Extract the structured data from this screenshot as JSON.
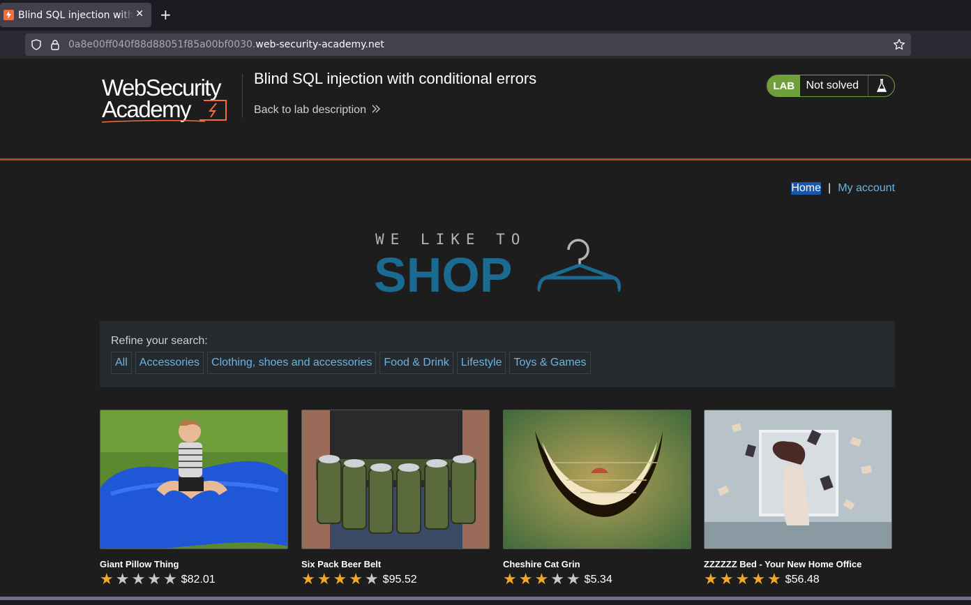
{
  "browser": {
    "tab_title": "Blind SQL injection with conditional errors",
    "tab_close": "✕",
    "new_tab": "+",
    "url_prefix": "0a8e00ff040f88d88051f85a00bf0030.",
    "url_domain": "web-security-academy.net"
  },
  "academy": {
    "logo_line1": "WebSecurity",
    "logo_line2": "Academy",
    "lab_title": "Blind SQL injection with conditional errors",
    "back_link": "Back to lab description",
    "lab_badge": "LAB",
    "lab_state": "Not solved"
  },
  "shop": {
    "nav": {
      "home": "Home",
      "separator": "|",
      "account": "My account"
    },
    "banner": {
      "tagline": "WE LIKE TO",
      "word": "SHOP"
    },
    "refine_label": "Refine your search:",
    "filters": [
      "All",
      "Accessories",
      "Clothing, shoes and accessories",
      "Food & Drink",
      "Lifestyle",
      "Toys & Games"
    ],
    "products": [
      {
        "name": "Giant Pillow Thing",
        "price": "$82.01",
        "rating": 1
      },
      {
        "name": "Six Pack Beer Belt",
        "price": "$95.52",
        "rating": 4
      },
      {
        "name": "Cheshire Cat Grin",
        "price": "$5.34",
        "rating": 3
      },
      {
        "name": "ZZZZZZ Bed - Your New Home Office",
        "price": "$56.48",
        "rating": 5
      }
    ]
  },
  "colors": {
    "accent_orange": "#b5441b",
    "lab_green": "#70a03e",
    "link_blue": "#6bb4e3",
    "star_gold": "#f5a623",
    "shop_blue": "#1b6a91"
  }
}
